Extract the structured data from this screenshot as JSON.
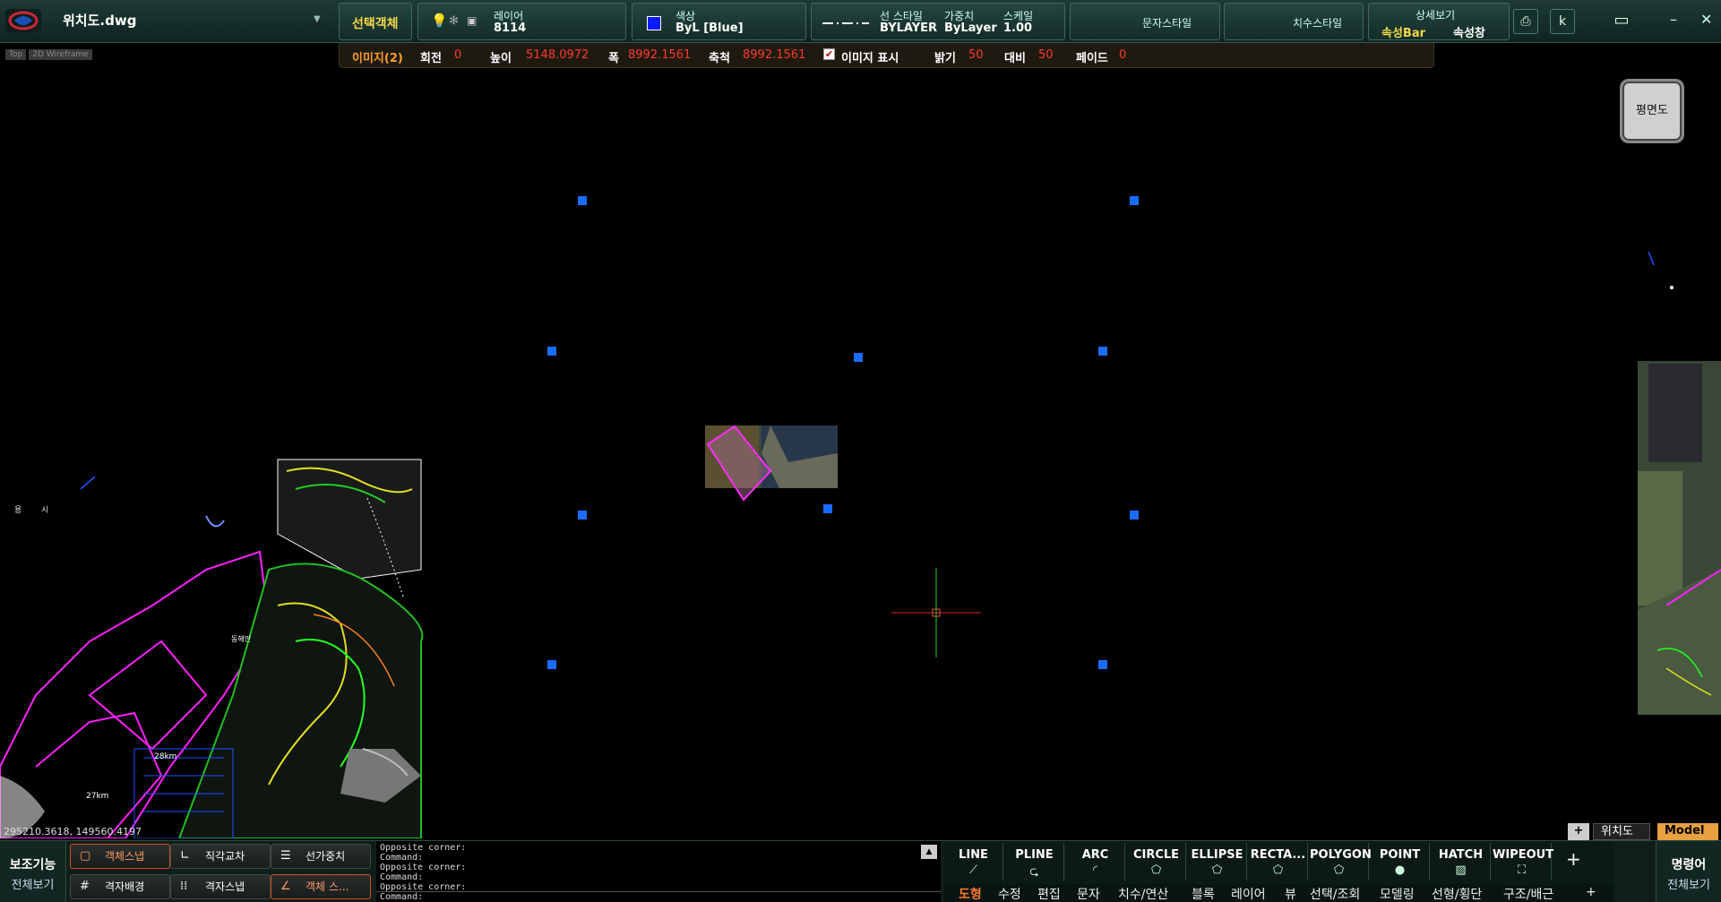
{
  "window": {
    "file_title": "위치도.dwg"
  },
  "header": {
    "selection_label": "선택객체",
    "layer": {
      "caption": "레이어",
      "value": "8114"
    },
    "color": {
      "caption": "색상",
      "value": "ByL [Blue]",
      "swatch": "#0a1cff"
    },
    "linestyle": {
      "caption": "선 스타일",
      "value": "BYLAYER"
    },
    "weight": {
      "caption": "가중치",
      "value": "ByLayer"
    },
    "scale": {
      "caption": "스케일",
      "value": "1.00"
    },
    "text_style": "문자스타일",
    "dim_style": "치수스타일",
    "detail": {
      "caption": "상세보기",
      "bar": "속성Bar",
      "window": "속성창"
    }
  },
  "image_bar": {
    "title": "이미지(2)",
    "rotation_label": "회전",
    "rotation": "0",
    "height_label": "높이",
    "height": "5148.0972",
    "width_label": "폭",
    "width": "8992.1561",
    "scale_label": "축척",
    "scale": "8992.1561",
    "show_label": "이미지 표시",
    "brightness_label": "밝기",
    "brightness": "50",
    "contrast_label": "대비",
    "contrast": "50",
    "fade_label": "페이드",
    "fade": "0"
  },
  "view_tags": [
    "Top",
    "2D Wireframe"
  ],
  "plan_button": "평면도",
  "coordinates": "295210.3618, 149560.4197",
  "map_labels": [
    "용",
    "시",
    "28km",
    "27km",
    "동해안"
  ],
  "layout_tabs": {
    "add": "+",
    "layout": "위치도",
    "model": "Model"
  },
  "aux": {
    "title": "보조기능",
    "sub": "전체보기"
  },
  "snaps": [
    {
      "label": "객체스냅",
      "icon": "square-snap-icon",
      "active": true
    },
    {
      "label": "직각교차",
      "icon": "ortho-icon",
      "active": false
    },
    {
      "label": "선가중치",
      "icon": "lineweight-icon",
      "active": false
    },
    {
      "label": "격자배경",
      "icon": "grid-bg-icon",
      "active": false
    },
    {
      "label": "격자스냅",
      "icon": "grid-snap-icon",
      "active": false
    },
    {
      "label": "객체 스...",
      "icon": "object-track-icon",
      "active": true
    }
  ],
  "command_log": [
    "Opposite corner:",
    "Command:",
    "Opposite corner:",
    "Command:",
    "Opposite corner:"
  ],
  "command_prompt": "Command:",
  "tools": [
    {
      "label": "LINE",
      "icon": "line-icon"
    },
    {
      "label": "PLINE",
      "icon": "pline-icon"
    },
    {
      "label": "ARC",
      "icon": "arc-icon"
    },
    {
      "label": "CIRCLE",
      "icon": "circle-icon"
    },
    {
      "label": "ELLIPSE",
      "icon": "ellipse-icon"
    },
    {
      "label": "RECTA...",
      "icon": "rectangle-icon"
    },
    {
      "label": "POLYGON",
      "icon": "polygon-icon"
    },
    {
      "label": "POINT",
      "icon": "point-icon"
    },
    {
      "label": "HATCH",
      "icon": "hatch-icon"
    },
    {
      "label": "WIPEOUT",
      "icon": "wipeout-icon"
    }
  ],
  "tool_add": "+",
  "categories": [
    "도형",
    "수정",
    "편집",
    "문자",
    "치수/연산",
    "블록",
    "레이어",
    "뷰",
    "선택/조회",
    "모델링",
    "선형/횡단",
    "구조/배근",
    "+"
  ],
  "command_panel": {
    "title": "명령어",
    "sub": "전체보기"
  }
}
